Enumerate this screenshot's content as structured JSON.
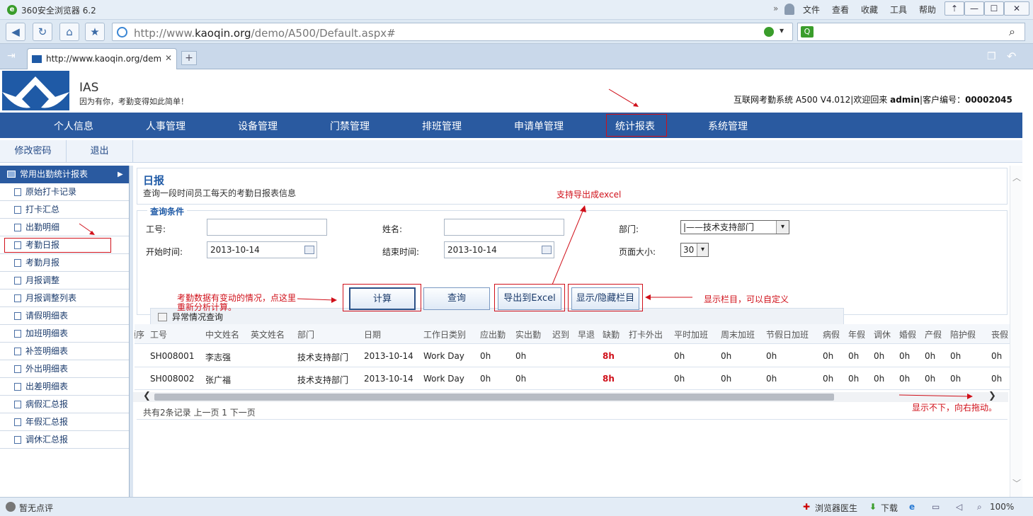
{
  "browser": {
    "title": "360安全浏览器 6.2",
    "menu": [
      "文件",
      "查看",
      "收藏",
      "工具",
      "帮助"
    ],
    "url_prefix": "http://www.",
    "url_domain": "kaoqin.org",
    "url_suffix": "/demo/A500/Default.aspx#",
    "tab_title": "http://www.kaoqin.org/demo",
    "status_left": "暂无点评",
    "status_doctor": "浏览器医生",
    "status_download": "下载",
    "zoom": "100%"
  },
  "header": {
    "app": "IAS",
    "slogan": "因为有你，考勤变得如此简单！",
    "sys_prefix": "互联网考勤系统 A500 V4.012|欢迎回来 ",
    "user": "admin",
    "sys_mid": "|客户编号：",
    "customer_no": "00002045"
  },
  "nav": [
    "个人信息",
    "人事管理",
    "设备管理",
    "门禁管理",
    "排班管理",
    "申请单管理",
    "统计报表",
    "系统管理"
  ],
  "subbar": [
    "修改密码",
    "退出"
  ],
  "sidebar": {
    "header": "常用出勤统计报表",
    "items": [
      "原始打卡记录",
      "打卡汇总",
      "出勤明细",
      "考勤日报",
      "考勤月报",
      "月报调整",
      "月报调整列表",
      "请假明细表",
      "加班明细表",
      "补签明细表",
      "外出明细表",
      "出差明细表",
      "病假汇总报",
      "年假汇总报",
      "调休汇总报"
    ]
  },
  "report": {
    "title": "日报",
    "desc": "查询一段时间员工每天的考勤日报表信息"
  },
  "query": {
    "legend": "查询条件",
    "emp_no_label": "工号:",
    "name_label": "姓名:",
    "dept_label": "部门:",
    "dept_value": "|——技术支持部门",
    "start_label": "开始时间:",
    "start_value": "2013-10-14",
    "end_label": "结束时间:",
    "end_value": "2013-10-14",
    "pagesize_label": "页面大小:",
    "pagesize_value": "30",
    "abnormal": "异常情况查询"
  },
  "buttons": {
    "calc": "计算",
    "query": "查询",
    "export": "导出到Excel",
    "toggle": "显示/隐藏栏目"
  },
  "notes": {
    "calc": "考勤数据有变动的情况，点这里",
    "calc2": "重新分析计算。",
    "export": "支持导出成excel",
    "toggle": "显示栏目，可以自定义",
    "scroll": "显示不下，向右拖动。"
  },
  "table": {
    "headers": [
      "顺序",
      "工号",
      "中文姓名",
      "英文姓名",
      "部门",
      "日期",
      "工作日类别",
      "应出勤",
      "实出勤",
      "迟到",
      "早退",
      "缺勤",
      "打卡外出",
      "平时加班",
      "周末加班",
      "节假日加班",
      "病假",
      "年假",
      "调休",
      "婚假",
      "产假",
      "陪护假",
      "丧假"
    ],
    "rows": [
      {
        "no": "SH008001",
        "name": "李志强",
        "dept": "技术支持部门",
        "date": "2013-10-14",
        "type": "Work Day",
        "should": "0h",
        "actual": "0h",
        "absent": "8h",
        "ot1": "0h",
        "ot2": "0h",
        "ot3": "0h",
        "sick": "0h",
        "annual": "0h",
        "comp": "0h",
        "marriage": "0h",
        "maternity": "0h",
        "care": "0h",
        "funeral": "0h"
      },
      {
        "no": "SH008002",
        "name": "张广福",
        "dept": "技术支持部门",
        "date": "2013-10-14",
        "type": "Work Day",
        "should": "0h",
        "actual": "0h",
        "absent": "8h",
        "ot1": "0h",
        "ot2": "0h",
        "ot3": "0h",
        "sick": "0h",
        "annual": "0h",
        "comp": "0h",
        "marriage": "0h",
        "maternity": "0h",
        "care": "0h",
        "funeral": "0h"
      }
    ]
  },
  "pager": "共有2条记录 上一页 1 下一页"
}
